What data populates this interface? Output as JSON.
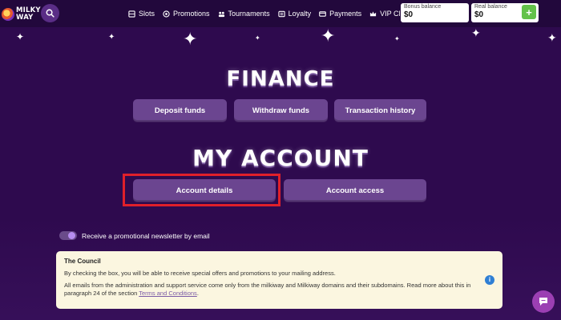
{
  "header": {
    "logo_line1": "MILKY",
    "logo_line2": "WAY",
    "nav": [
      {
        "label": "Slots",
        "icon": "slots-icon"
      },
      {
        "label": "Promotions",
        "icon": "promotions-icon"
      },
      {
        "label": "Tournaments",
        "icon": "tournaments-icon"
      },
      {
        "label": "Loyalty",
        "icon": "loyalty-icon"
      },
      {
        "label": "Payments",
        "icon": "payments-icon"
      },
      {
        "label": "VIP Club",
        "icon": "vip-icon"
      }
    ],
    "bonus_balance_label": "Bonus balance",
    "bonus_balance_value": "$0",
    "real_balance_label": "Real balance",
    "real_balance_value": "$0",
    "plus_label": "+"
  },
  "finance": {
    "title": "FINANCE",
    "deposit_label": "Deposit funds",
    "withdraw_label": "Withdraw funds",
    "history_label": "Transaction history"
  },
  "account": {
    "title": "MY ACCOUNT",
    "details_label": "Account details",
    "access_label": "Account access"
  },
  "newsletter": {
    "label": "Receive a promotional newsletter by email",
    "enabled": true
  },
  "notice": {
    "title": "The Council",
    "paragraph1": "By checking the box, you will be able to receive special offers and promotions to your mailing address.",
    "paragraph2_text": "All emails from the administration and support service come only from the milkiway and Milkiway domains and their subdomains. Read more about this in paragraph 24 of the section ",
    "link_text": "Terms and Conditions",
    "paragraph2_end": ".",
    "info_glyph": "i"
  },
  "colors": {
    "background": "#2e0a4e",
    "button": "#6b4590",
    "highlight": "#e0202a",
    "plus": "#63c24a",
    "notice": "#fbf6e0"
  }
}
